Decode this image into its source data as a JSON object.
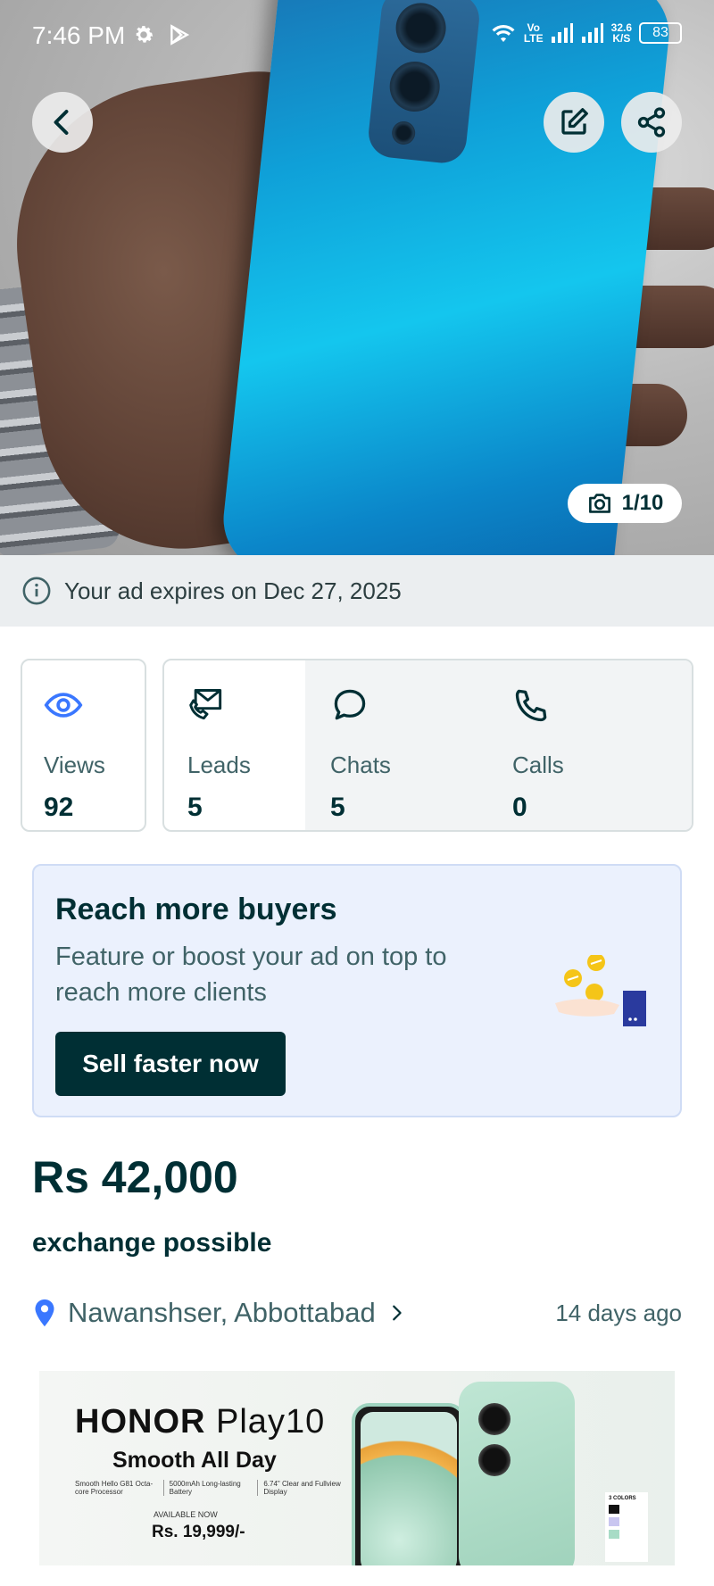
{
  "status_bar": {
    "time": "7:46 PM",
    "net_speed_top": "32.6",
    "net_speed_bottom": "K/S",
    "volte_top": "Vo",
    "volte_bottom": "LTE",
    "battery": "83"
  },
  "hero": {
    "photo_counter": "1/10"
  },
  "expiry": {
    "text": "Your ad expires on Dec 27, 2025"
  },
  "stats": {
    "views": {
      "label": "Views",
      "value": "92"
    },
    "leads": {
      "label": "Leads",
      "value": "5"
    },
    "chats": {
      "label": "Chats",
      "value": "5"
    },
    "calls": {
      "label": "Calls",
      "value": "0"
    }
  },
  "promo": {
    "title": "Reach more buyers",
    "description": "Feature or boost your ad on top to reach more clients",
    "button_label": "Sell faster now"
  },
  "listing": {
    "price": "Rs 42,000",
    "subtitle": "exchange possible",
    "location": "Nawanshser, Abbottabad",
    "posted": "14 days ago"
  },
  "ad_banner": {
    "brand": "HONOR",
    "model": "Play10",
    "tagline": "Smooth All Day",
    "spec1": "Smooth Hello G81 Octa-core Processor",
    "spec2": "5000mAh Long-lasting Battery",
    "spec3": "6.74\" Clear and Fullview Display",
    "availability": "AVAILABLE NOW",
    "price": "Rs. 19,999/-",
    "colors_label": "3 COLORS"
  },
  "colors": {
    "primary": "#002f34",
    "expiry_bg": "#ebeef0",
    "promo_bg": "#ebf1fd",
    "accent_blue": "#3a77ff"
  }
}
